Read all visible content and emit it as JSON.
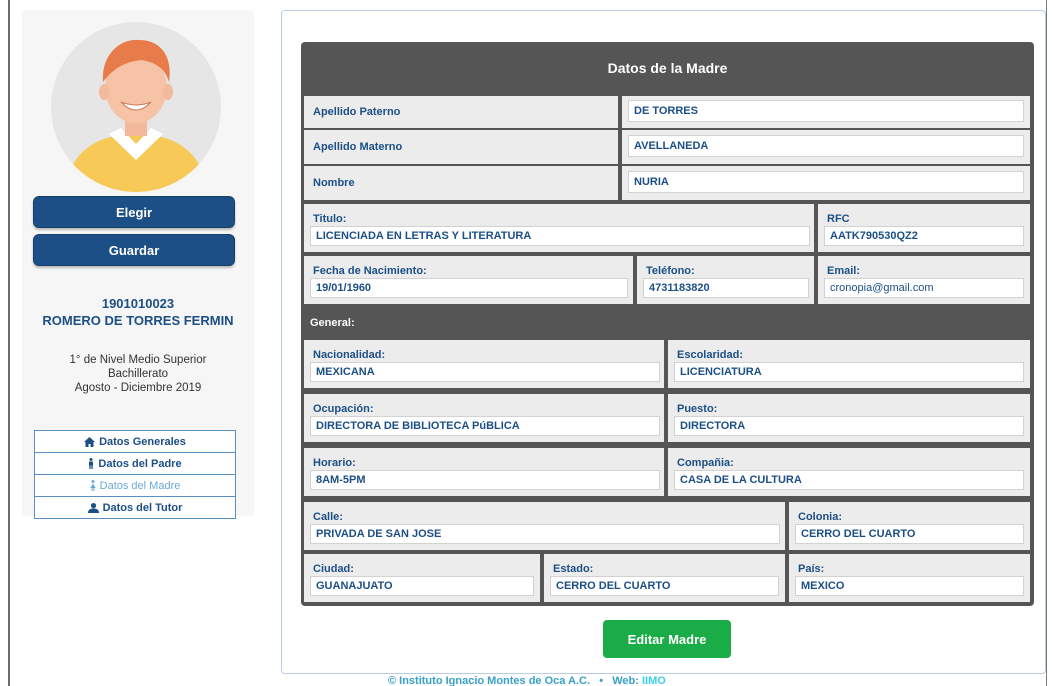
{
  "sidebar": {
    "elegir_label": "Elegir",
    "guardar_label": "Guardar",
    "student_id": "1901010023",
    "student_name": "ROMERO DE TORRES FERMIN",
    "level": "1° de Nivel Medio Superior",
    "program": "Bachillerato",
    "period": "Agosto - Diciembre 2019",
    "nav": [
      {
        "label": "Datos Generales",
        "icon": "home-icon"
      },
      {
        "label": "Datos del Padre",
        "icon": "male-icon"
      },
      {
        "label": "Datos del Madre",
        "icon": "female-icon"
      },
      {
        "label": "Datos del Tutor",
        "icon": "user-icon"
      }
    ]
  },
  "form": {
    "title": "Datos de la Madre",
    "apellido_paterno": {
      "label": "Apellido Paterno",
      "value": "DE TORRES"
    },
    "apellido_materno": {
      "label": "Apellido Materno",
      "value": "AVELLANEDA"
    },
    "nombre": {
      "label": "Nombre",
      "value": "NURIA"
    },
    "titulo": {
      "label": "Titulo:",
      "value": "LICENCIADA EN LETRAS Y LITERATURA"
    },
    "rfc": {
      "label": "RFC",
      "value": "AATK790530QZ2"
    },
    "fecha_nacimiento": {
      "label": "Fecha de Nacimiento:",
      "value": "19/01/1960"
    },
    "telefono": {
      "label": "Teléfono:",
      "value": "4731183820"
    },
    "email": {
      "label": "Email:",
      "value": "cronopia@gmail.com"
    },
    "general_label": "General:",
    "nacionalidad": {
      "label": "Nacionalidad:",
      "value": "MEXICANA"
    },
    "escolaridad": {
      "label": "Escolaridad:",
      "value": "LICENCIATURA"
    },
    "ocupacion": {
      "label": "Ocupación:",
      "value": "DIRECTORA DE BIBLIOTECA PúBLICA"
    },
    "puesto": {
      "label": "Puesto:",
      "value": "DIRECTORA"
    },
    "horario": {
      "label": "Horario:",
      "value": "8AM-5PM"
    },
    "compania": {
      "label": "Compañia:",
      "value": "CASA DE LA CULTURA"
    },
    "calle": {
      "label": "Calle:",
      "value": "PRIVADA DE SAN JOSE"
    },
    "colonia": {
      "label": "Colonia:",
      "value": "CERRO DEL CUARTO"
    },
    "ciudad": {
      "label": "Ciudad:",
      "value": "GUANAJUATO"
    },
    "estado": {
      "label": "Estado:",
      "value": "CERRO DEL CUARTO"
    },
    "pais": {
      "label": "País:",
      "value": "MEXICO"
    },
    "edit_label": "Editar Madre"
  },
  "footer": {
    "copyright": "© Instituto Ignacio Montes de Oca A.C.",
    "separator": "•",
    "web_label": "Web:",
    "web_link": "IIMO"
  },
  "colors": {
    "primary": "#1c4f85",
    "card_bg": "#555555",
    "cell_bg": "#ececec",
    "success": "#1aac46"
  }
}
